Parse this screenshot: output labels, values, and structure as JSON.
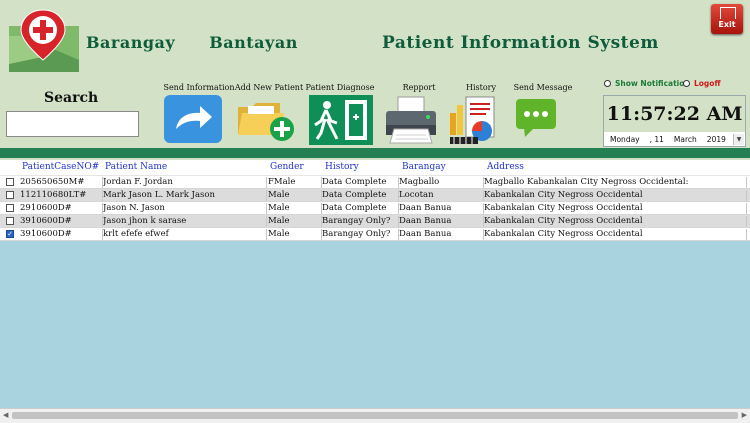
{
  "header": {
    "brand_left": "Barangay",
    "brand_right": "Bantayan",
    "system_title": "Patient Information System",
    "exit_label": "Exit",
    "logo_icon": "medical-cross-map-pin-icon"
  },
  "search": {
    "label": "Search",
    "value": ""
  },
  "toolbar": [
    {
      "label": "Send Information",
      "icon": "send-arrow-icon"
    },
    {
      "label": "Add New Patient",
      "icon": "folder-add-icon"
    },
    {
      "label": "Patient Diagnose",
      "icon": "exit-door-icon"
    },
    {
      "label": "Repport",
      "icon": "printer-icon"
    },
    {
      "label": "History",
      "icon": "report-chart-icon"
    },
    {
      "label": "Send Message",
      "icon": "chat-bubble-icon"
    }
  ],
  "options": {
    "show_notification": "Show Notification",
    "logoff": "Logoff"
  },
  "clock": {
    "time": "11:57:22 AM",
    "weekday": "Monday",
    "day": ", 11",
    "month": "March",
    "year": "2019"
  },
  "table": {
    "columns": [
      "PatientCaseNO#",
      "Patient Name",
      "Gender",
      "History",
      "Barangay",
      "Address"
    ],
    "rows": [
      {
        "checked": false,
        "case": "205650650M#",
        "name": "Jordan      F.      Jordan",
        "gender": "FMale",
        "history": "Data Complete",
        "barangay": "Magballo",
        "address": "Magballo Kabankalan City Negross Occidental:"
      },
      {
        "checked": false,
        "case": "112110680LT#",
        "name": "Mark Jason     L.     Mark Jason",
        "gender": "Male",
        "history": "Data Complete",
        "barangay": "Locotan",
        "address": " Kabankalan City Negross Occidental"
      },
      {
        "checked": false,
        "case": "2910600D#",
        "name": "Jason     N.     Jason",
        "gender": "Male",
        "history": "Data Complete",
        "barangay": "Daan Banua",
        "address": " Kabankalan City Negross Occidental"
      },
      {
        "checked": false,
        "case": "3910600D#",
        "name": "Jason jhon     k     sarase",
        "gender": "Male",
        "history": "Barangay Only?",
        "barangay": "Daan Banua",
        "address": " Kabankalan City Negross Occidental"
      },
      {
        "checked": true,
        "case": "3910600D#",
        "name": "krlt     efefe     efwef",
        "gender": "Male",
        "history": "Barangay Only?",
        "barangay": "Daan Banua",
        "address": "Kabankalan City Negross Occidental"
      }
    ]
  },
  "colors": {
    "header_bg": "#d3e2c6",
    "accent_green": "#247f52",
    "title_green": "#0f5c3c",
    "grid_bg": "#a9d3df",
    "header_text": "#2233cc"
  }
}
